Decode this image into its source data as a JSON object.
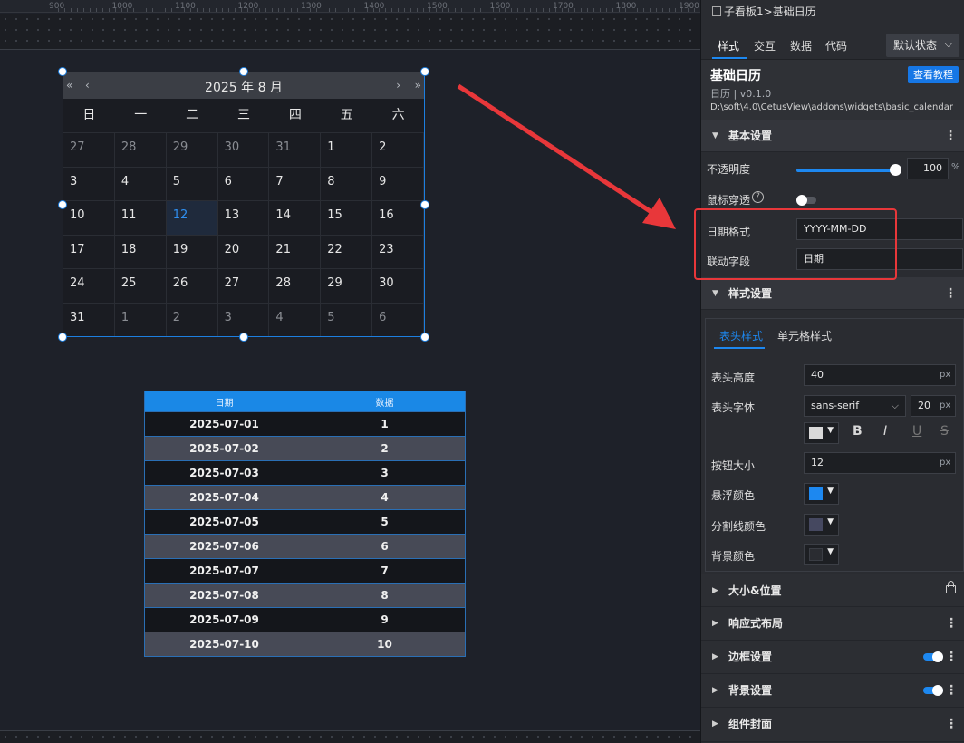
{
  "ruler": {
    "ticks": [
      "900",
      "1000",
      "1100",
      "1200",
      "1300",
      "1400",
      "1500",
      "1600",
      "1700",
      "1800",
      "1900"
    ]
  },
  "calendar": {
    "title": "2025 年 8 月",
    "nav": {
      "prev_year": "«",
      "prev_month": "‹",
      "next_month": "›",
      "next_year": "»"
    },
    "weekdays": [
      "日",
      "一",
      "二",
      "三",
      "四",
      "五",
      "六"
    ],
    "days": [
      "27",
      "28",
      "29",
      "30",
      "31",
      "1",
      "2",
      "3",
      "4",
      "5",
      "6",
      "7",
      "8",
      "9",
      "10",
      "11",
      "12",
      "13",
      "14",
      "15",
      "16",
      "17",
      "18",
      "19",
      "20",
      "21",
      "22",
      "23",
      "24",
      "25",
      "26",
      "27",
      "28",
      "29",
      "30",
      "31",
      "1",
      "2",
      "3",
      "4",
      "5",
      "6"
    ],
    "selected_day": "12"
  },
  "table": {
    "headers": [
      "日期",
      "数据"
    ],
    "rows": [
      [
        "2025-07-01",
        "1"
      ],
      [
        "2025-07-02",
        "2"
      ],
      [
        "2025-07-03",
        "3"
      ],
      [
        "2025-07-04",
        "4"
      ],
      [
        "2025-07-05",
        "5"
      ],
      [
        "2025-07-06",
        "6"
      ],
      [
        "2025-07-07",
        "7"
      ],
      [
        "2025-07-08",
        "8"
      ],
      [
        "2025-07-09",
        "9"
      ],
      [
        "2025-07-10",
        "10"
      ]
    ]
  },
  "panel": {
    "breadcrumb": {
      "parent": "子看板1",
      "sep": ">",
      "current": "基础日历"
    },
    "tabs": [
      "样式",
      "交互",
      "数据",
      "代码"
    ],
    "state_select": "默认状态",
    "component": {
      "name": "基础日历",
      "version": "日历 | v0.1.0",
      "path": "D:\\soft\\4.0\\CetusView\\addons\\widgets\\basic_calendar",
      "tutorial_button": "查看教程"
    },
    "basic": {
      "title": "基本设置",
      "opacity_label": "不透明度",
      "opacity_value": "100",
      "opacity_unit": "%",
      "opacity_level": 1.0,
      "mouse_through_label": "鼠标穿透",
      "help_icon": "?",
      "date_format_label": "日期格式",
      "date_format_value": "YYYY-MM-DD",
      "link_field_label": "联动字段",
      "link_field_value": "日期"
    },
    "style": {
      "title": "样式设置",
      "subtabs": [
        "表头样式",
        "单元格样式"
      ],
      "header_height_label": "表头高度",
      "header_height_value": "40",
      "header_height_unit": "px",
      "header_font_label": "表头字体",
      "header_font_value": "sans-serif",
      "header_font_size": "20",
      "header_font_unit": "px",
      "header_font_color": "#d9d9d9",
      "format_buttons": {
        "bold": "B",
        "italic": "I",
        "underline": "U",
        "strike": "S"
      },
      "button_size_label": "按钮大小",
      "button_size_value": "12",
      "button_size_unit": "px",
      "hover_color_label": "悬浮颜色",
      "hover_color": "#1d88f0",
      "divider_color_label": "分割线颜色",
      "divider_color": "#454860",
      "bg_color_label": "背景颜色",
      "bg_color": "#2a2c31"
    },
    "sections": {
      "size_position": "大小&位置",
      "responsive": "响应式布局",
      "border": "边框设置",
      "background": "背景设置",
      "cover": "组件封面"
    }
  },
  "colors": {
    "accent": "#1d88f0",
    "highlight": "#e8373a"
  }
}
